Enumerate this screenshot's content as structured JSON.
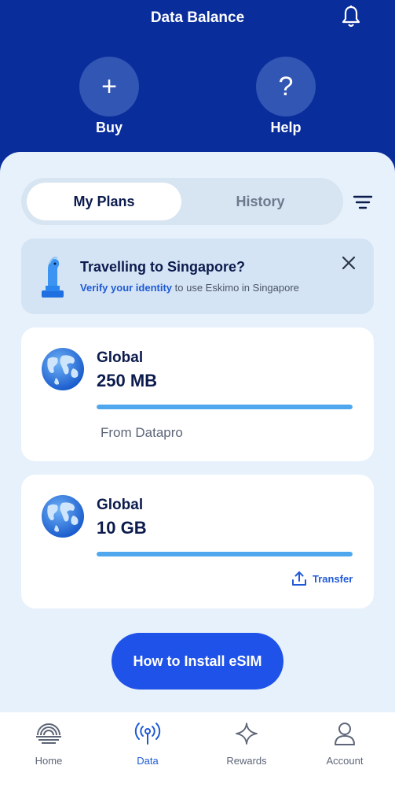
{
  "header": {
    "title": "Data Balance",
    "quick_actions": [
      {
        "label": "Buy",
        "glyph": "+"
      },
      {
        "label": "Help",
        "glyph": "?"
      }
    ]
  },
  "tabs": [
    {
      "label": "My Plans",
      "active": true
    },
    {
      "label": "History",
      "active": false
    }
  ],
  "notice": {
    "title": "Travelling to Singapore?",
    "link_text": "Verify your identity",
    "rest_text": " to use Eskimo in Singapore"
  },
  "plans": [
    {
      "name": "Global",
      "amount": "250 MB",
      "remaining_fraction": 1.0,
      "footer": "From Datapro"
    },
    {
      "name": "Global",
      "amount": "10 GB",
      "remaining_fraction": 1.0,
      "action_label": "Transfer"
    }
  ],
  "cta": {
    "label": "How to Install eSIM"
  },
  "nav": [
    {
      "label": "Home",
      "icon": "home-icon",
      "active": false
    },
    {
      "label": "Data",
      "icon": "antenna-icon",
      "active": true
    },
    {
      "label": "Rewards",
      "icon": "sparkle-icon",
      "active": false
    },
    {
      "label": "Account",
      "icon": "person-icon",
      "active": false
    }
  ],
  "colors": {
    "header_bg": "#0a2d9c",
    "accent": "#1f52e8",
    "progress": "#4fa7ee",
    "sheet_bg": "#e7f1fb"
  }
}
